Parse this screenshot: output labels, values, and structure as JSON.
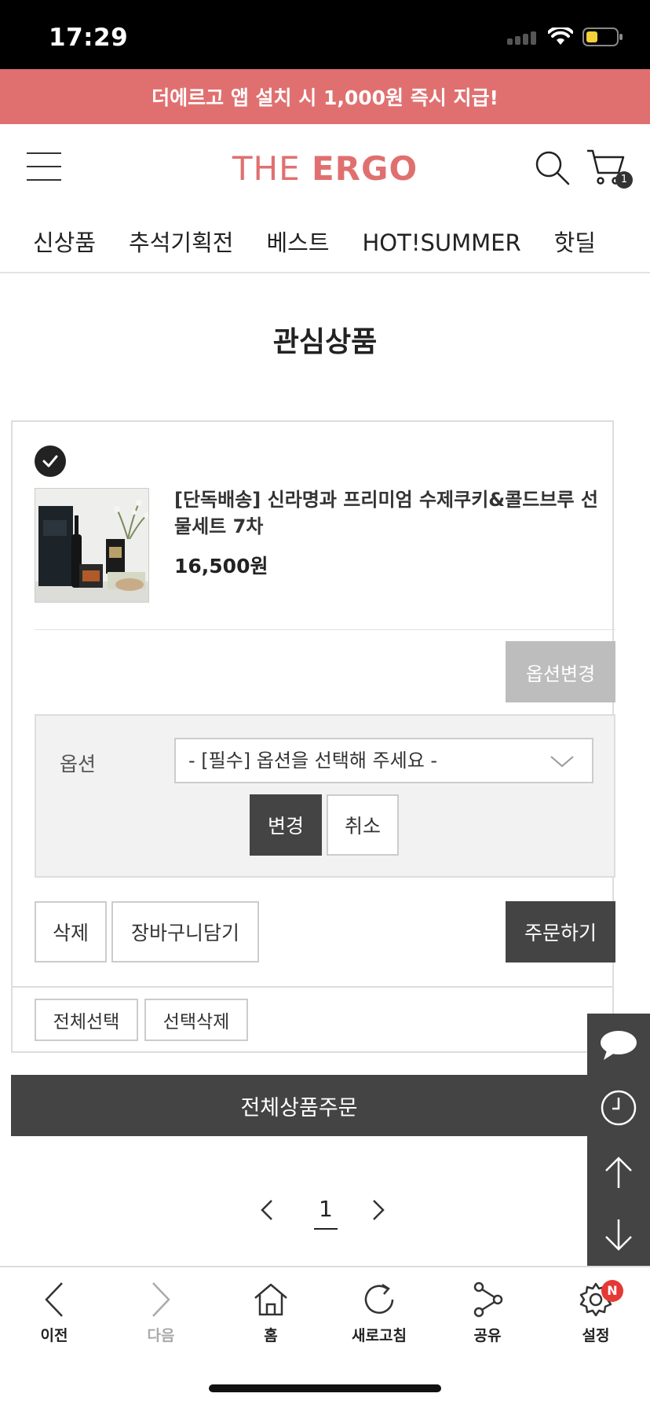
{
  "status_bar": {
    "time": "17:29"
  },
  "promo": {
    "text": "더에르고 앱 설치 시 1,000원 즉시 지급!"
  },
  "header": {
    "logo_part1": "THE ",
    "logo_part2": "ERGO",
    "cart_count": "1"
  },
  "nav": {
    "items": [
      "신상품",
      "추석기획전",
      "베스트",
      "HOT!SUMMER",
      "핫딜"
    ]
  },
  "page": {
    "title": "관심상품"
  },
  "product": {
    "name": "[단독배송] 신라명과 프리미엄 수제쿠키&콜드브루 선물세트 7차",
    "price": "16,500원",
    "option_change_label": "옵션변경",
    "option_label": "옵션",
    "option_placeholder": "- [필수] 옵션을 선택해 주세요 -",
    "apply_label": "변경",
    "cancel_label": "취소",
    "delete_label": "삭제",
    "add_cart_label": "장바구니담기",
    "order_label": "주문하기"
  },
  "list_actions": {
    "select_all": "전체선택",
    "delete_selected": "선택삭제"
  },
  "order_all": "전체상품주문",
  "pagination": {
    "current": "1"
  },
  "bottom_nav": {
    "back": "이전",
    "forward": "다음",
    "home": "홈",
    "refresh": "새로고침",
    "share": "공유",
    "settings": "설정",
    "settings_badge": "N"
  },
  "colors": {
    "brand": "#e07070",
    "dark_button": "#444444",
    "disabled_button": "#bdbdbd"
  }
}
